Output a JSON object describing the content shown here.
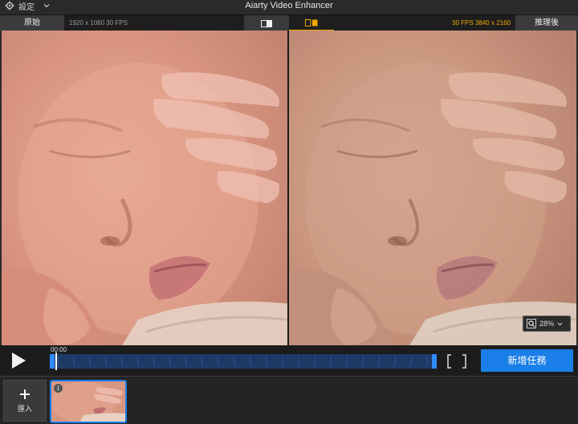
{
  "titlebar": {
    "settings_label": "設定",
    "title": "Aiarty Video Enhancer"
  },
  "viewbar": {
    "original_tab": "原始",
    "original_meta": "1920 x 1080  30 FPS",
    "enhanced_meta": "30 FPS  3840 x 2160",
    "enhanced_tab": "推理後",
    "active_mode": "split"
  },
  "zoom": {
    "value": "28%"
  },
  "playback": {
    "time": "00:00",
    "new_task_label": "新增任務"
  },
  "bottom": {
    "import_label": "匯入",
    "info_label": "i"
  },
  "colors": {
    "accent_blue": "#1a7fe8",
    "accent_orange": "#f0a800",
    "timeline_track": "#1d3a66"
  },
  "icons": [
    "gear-icon",
    "chevron-down-icon",
    "single-view-icon",
    "split-view-icon",
    "zoom-icon",
    "play-icon",
    "bracket-icon",
    "plus-icon",
    "info-icon"
  ]
}
